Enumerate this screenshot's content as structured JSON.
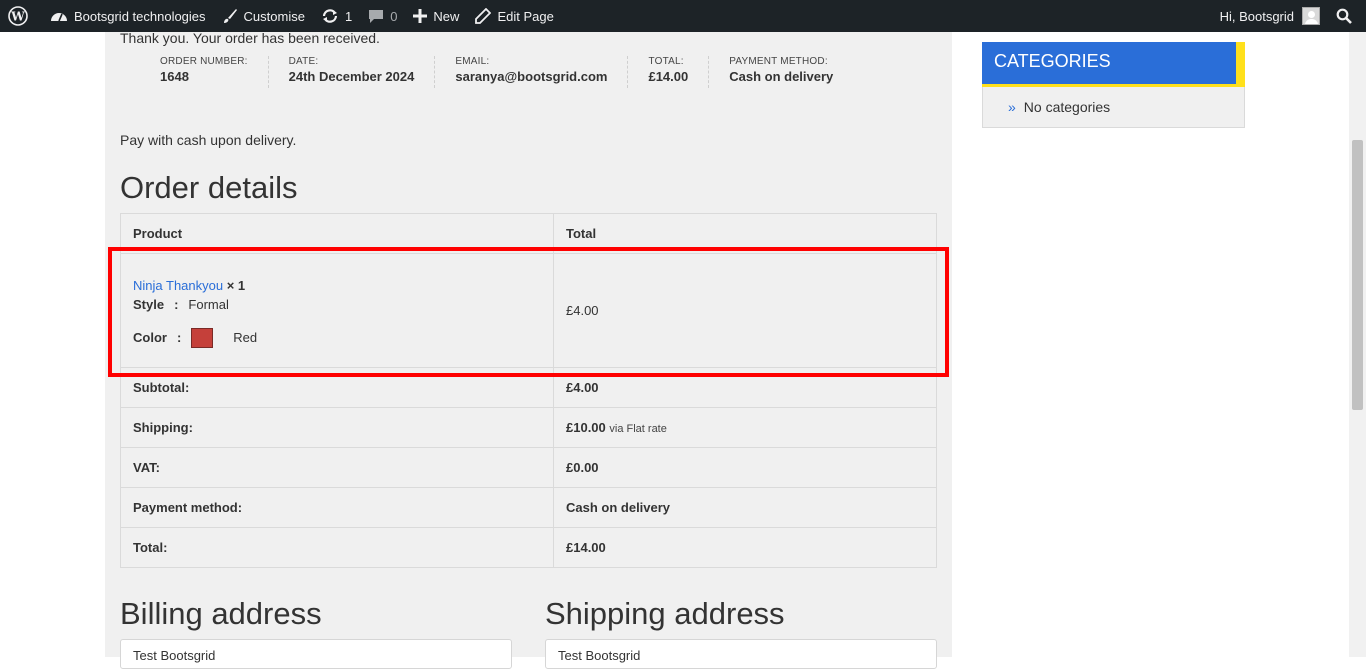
{
  "admin_bar": {
    "site_name": "Bootsgrid technologies",
    "customise": "Customise",
    "updates_count": "1",
    "comments_count": "0",
    "new_label": "New",
    "edit_page": "Edit Page",
    "greeting": "Hi, Bootsgrid"
  },
  "order": {
    "thanks_message": "Thank you. Your order has been received.",
    "overview": [
      {
        "label": "ORDER NUMBER:",
        "value": "1648"
      },
      {
        "label": "DATE:",
        "value": "24th December 2024"
      },
      {
        "label": "EMAIL:",
        "value": "saranya@bootsgrid.com"
      },
      {
        "label": "TOTAL:",
        "value": "£14.00"
      },
      {
        "label": "PAYMENT METHOD:",
        "value": "Cash on delivery"
      }
    ],
    "payment_note": "Pay with cash upon delivery.",
    "details_title": "Order details",
    "table": {
      "header_product": "Product",
      "header_total": "Total",
      "item": {
        "name": "Ninja Thankyou",
        "qty": "× 1",
        "style_key": "Style",
        "style_value": "Formal",
        "color_key": "Color",
        "color_value": "Red",
        "color_hex": "#c5403a",
        "total": "£4.00"
      },
      "subtotal_label": "Subtotal:",
      "subtotal_value": "£4.00",
      "shipping_label": "Shipping:",
      "shipping_value": "£10.00",
      "shipping_via": "via Flat rate",
      "vat_label": "VAT:",
      "vat_value": "£0.00",
      "payment_label": "Payment method:",
      "payment_value": "Cash on delivery",
      "total_label": "Total:",
      "total_value": "£14.00"
    },
    "billing_title": "Billing address",
    "shipping_title": "Shipping address",
    "billing_name": "Test Bootsgrid",
    "shipping_name": "Test Bootsgrid"
  },
  "sidebar": {
    "categories_title": "CATEGORIES",
    "no_categories": "No categories"
  },
  "colors": {
    "admin_bar_bg": "#1d2327",
    "accent_blue": "#2a6ed8",
    "accent_yellow": "#ffe01b",
    "highlight_red": "#ff0000"
  },
  "separator": ":"
}
